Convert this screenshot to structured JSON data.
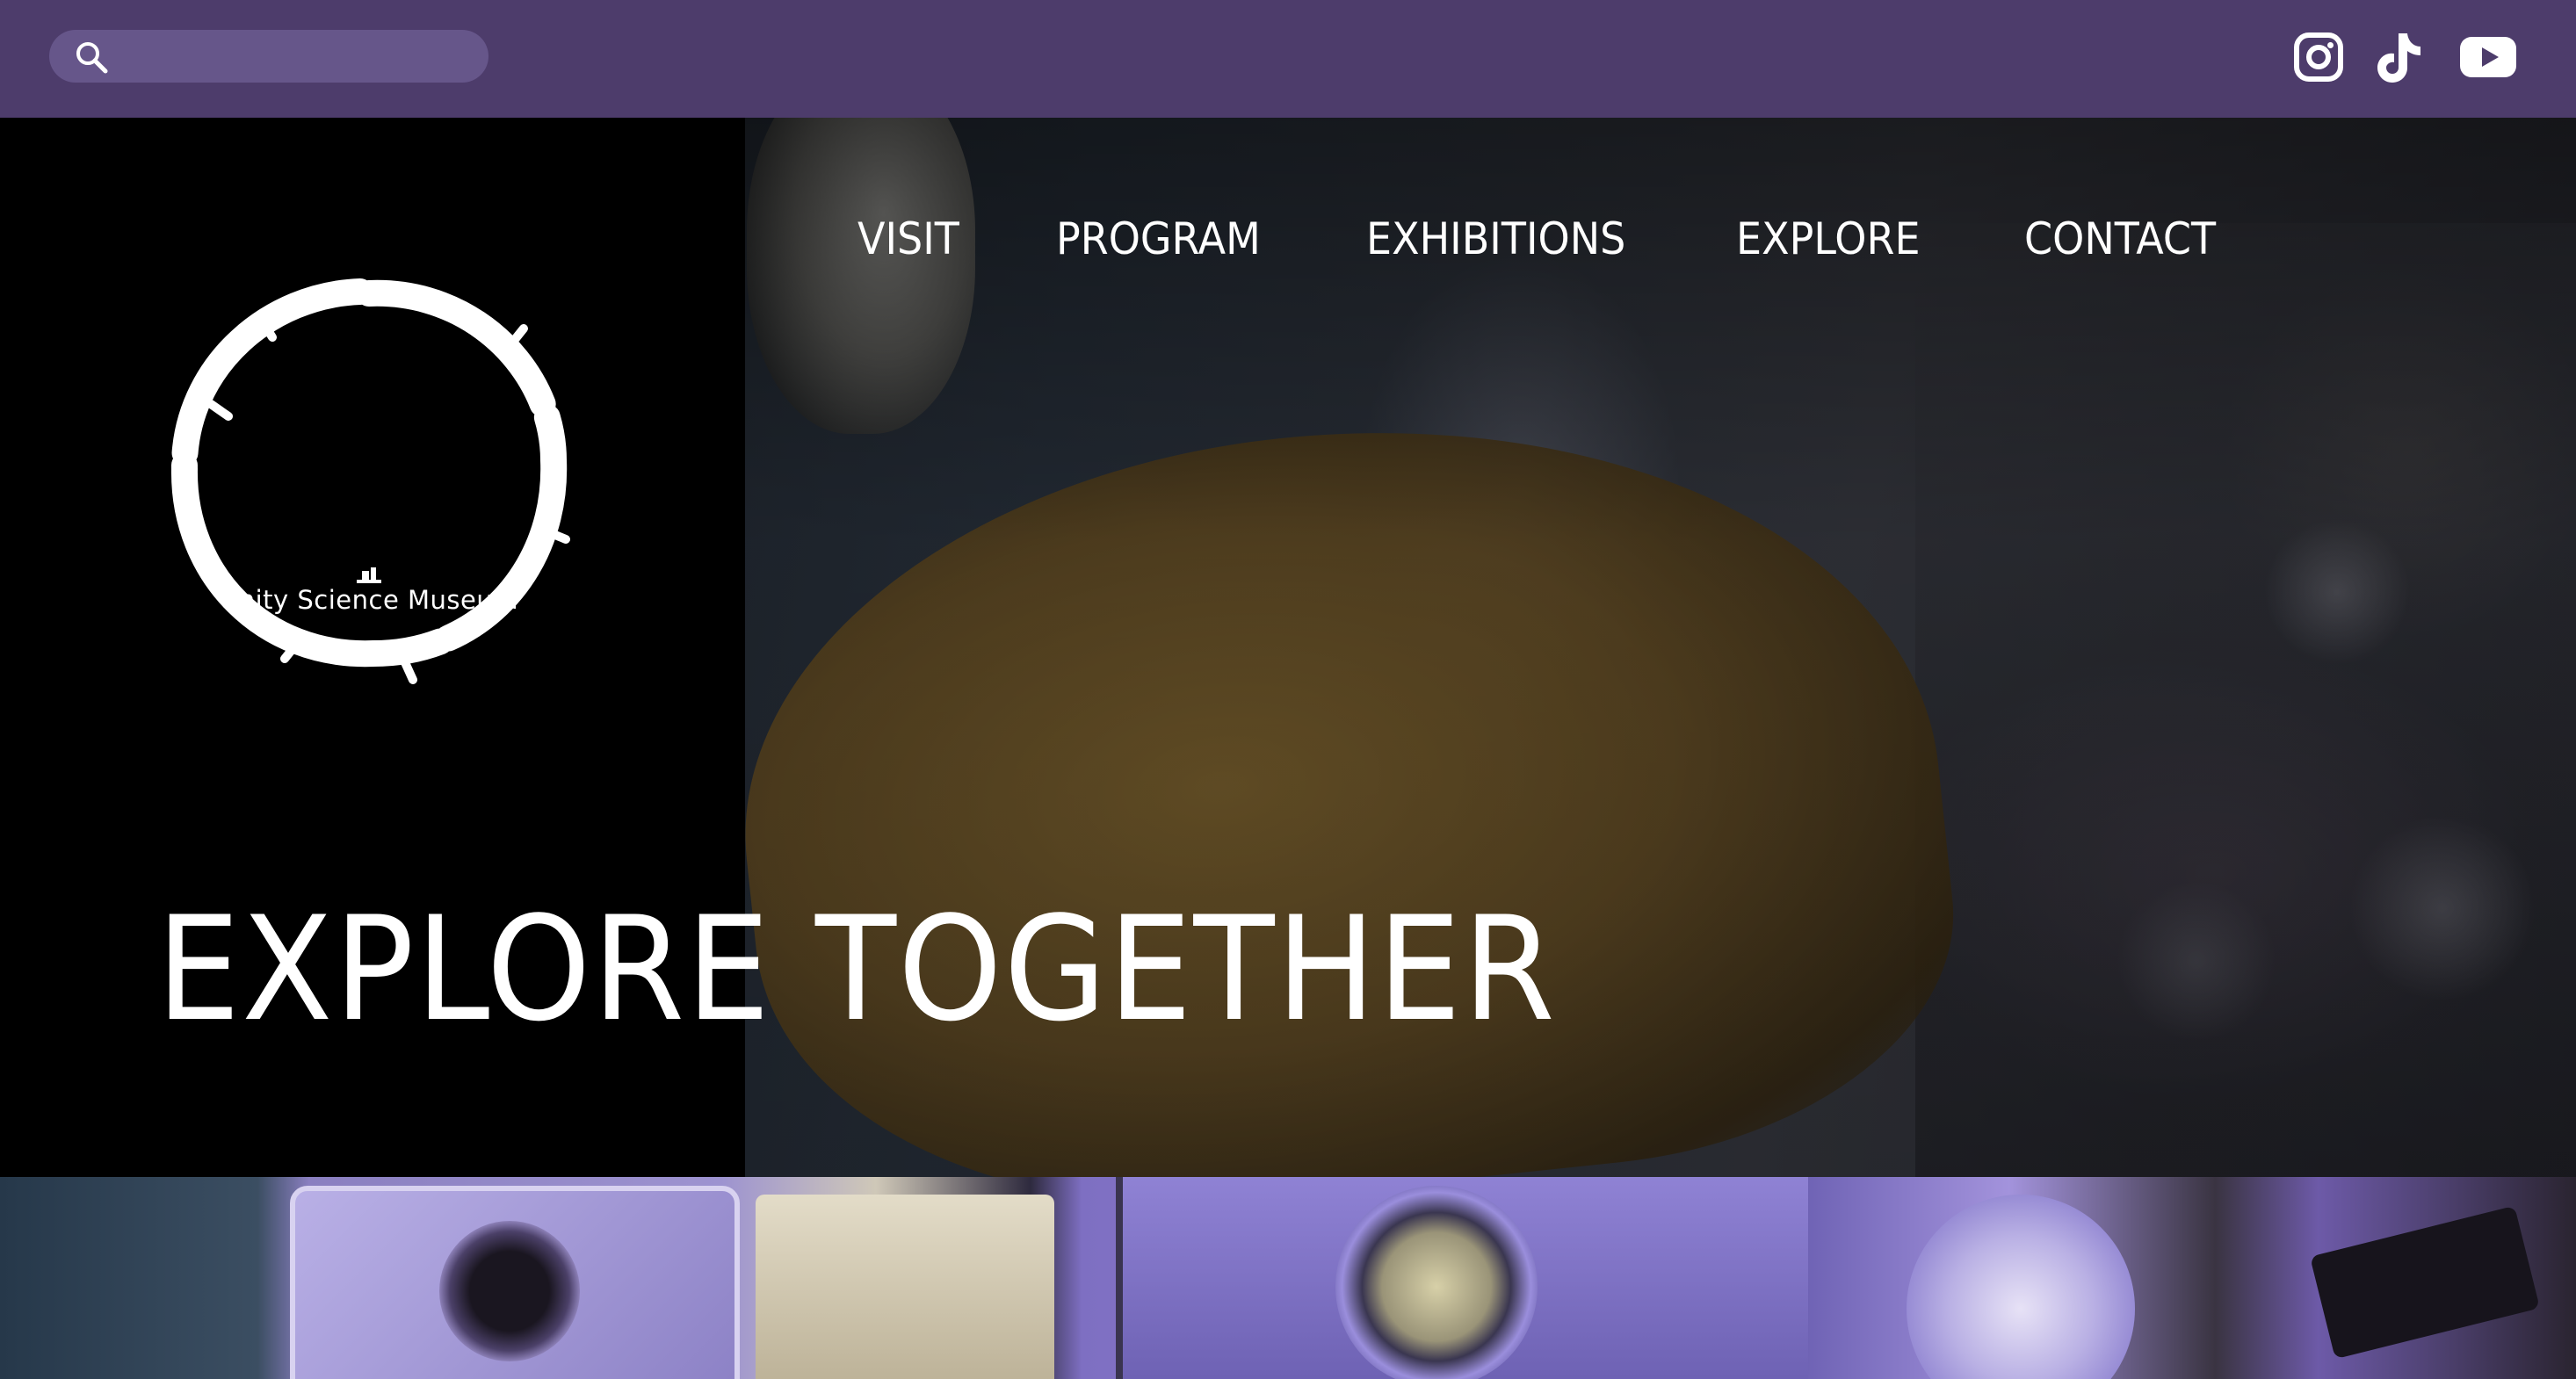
{
  "colors": {
    "topbar": "#4d3c6b",
    "search_bg": "#66568a",
    "text": "#ffffff",
    "logo_panel": "#000000"
  },
  "search": {
    "placeholder": "",
    "icon": "search-icon"
  },
  "social": [
    {
      "name": "instagram",
      "icon": "instagram-icon"
    },
    {
      "name": "tiktok",
      "icon": "tiktok-icon"
    },
    {
      "name": "youtube",
      "icon": "youtube-icon"
    }
  ],
  "logo": {
    "text": "Unity Science Museum"
  },
  "nav": {
    "items": [
      "VISIT",
      "PROGRAM",
      "EXHIBITIONS",
      "EXPLORE",
      "CONTACT"
    ]
  },
  "hero": {
    "title": "EXPLORE TOGETHER"
  }
}
